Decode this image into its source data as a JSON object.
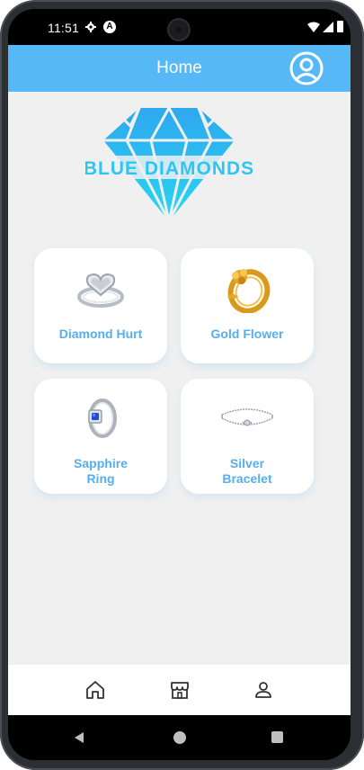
{
  "status_bar": {
    "time": "11:51",
    "icons": [
      "gear-icon",
      "a-notification-icon",
      "wifi-icon",
      "signal-icon",
      "battery-icon"
    ]
  },
  "app_bar": {
    "title": "Home",
    "background": "#56b8f7",
    "right_icon": "account-circle-icon"
  },
  "logo": {
    "text": "BLUE DIAMONDS",
    "color": "#2ec4f4"
  },
  "products": [
    {
      "name": "Diamond Hurt",
      "icon": "heart-diamond-ring-image"
    },
    {
      "name": "Gold Flower",
      "icon": "gold-flower-ring-image"
    },
    {
      "name": "Sapphire Ring",
      "line1": "Sapphire",
      "line2": "Ring",
      "icon": "sapphire-ring-image"
    },
    {
      "name": "Silver Bracelet",
      "line1": "Silver",
      "line2": "Bracelet",
      "icon": "silver-bracelet-image"
    }
  ],
  "bottom_nav": {
    "items": [
      "home-icon",
      "store-icon",
      "profile-icon"
    ]
  },
  "system_nav": [
    "back-button",
    "home-button",
    "recents-button"
  ],
  "colors": {
    "accent": "#56b8f7",
    "label": "#56aef0",
    "background": "#f0f0f0",
    "card": "#ffffff"
  }
}
